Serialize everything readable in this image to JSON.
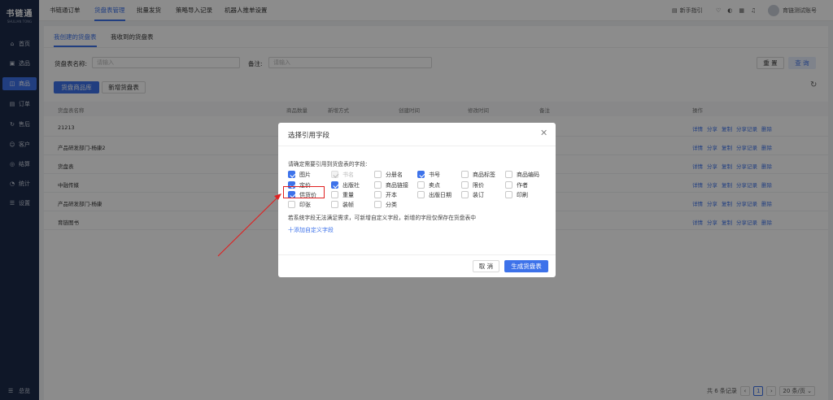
{
  "sidebar": {
    "logo_title": "书链通",
    "logo_sub": "SHULIAN TONG",
    "items": [
      {
        "label": "首页",
        "icon": "home-icon"
      },
      {
        "label": "选品",
        "icon": "select-icon"
      },
      {
        "label": "商品",
        "icon": "goods-icon"
      },
      {
        "label": "订单",
        "icon": "order-icon"
      },
      {
        "label": "售后",
        "icon": "aftersale-icon"
      },
      {
        "label": "客户",
        "icon": "customer-icon"
      },
      {
        "label": "结算",
        "icon": "settle-icon"
      },
      {
        "label": "统计",
        "icon": "stats-icon"
      },
      {
        "label": "设置",
        "icon": "settings-icon"
      }
    ],
    "active_index": 2,
    "bottom_label": "总览"
  },
  "topbar": {
    "nav": [
      "书链通订单",
      "货盘表管理",
      "批量发货",
      "策略导入记录",
      "机器人推单设置"
    ],
    "active_index": 1,
    "guide": "新手指引",
    "user": "育链测试账号"
  },
  "main": {
    "tabs": [
      "我创建的货盘表",
      "我收到的货盘表"
    ],
    "active_tab": 0,
    "filters": {
      "name_label": "货盘表名称:",
      "name_placeholder": "请输入",
      "remark_label": "备注:",
      "remark_placeholder": "请输入"
    },
    "reset_button": "重 置",
    "query_button": "查 询",
    "library_button": "货盘商品库",
    "new_button": "新增货盘表",
    "table": {
      "headers": [
        "货盘表名称",
        "商品数量",
        "新增方式",
        "创建时间",
        "修改时间",
        "备注",
        "操作"
      ],
      "rows": [
        "21213",
        "产品研发部门-杨康2",
        "货盘表",
        "中融传媒",
        "产品研发部门-杨康",
        "育链图书"
      ],
      "ops": [
        "详情",
        "分享",
        "复制",
        "分享记录",
        "删除"
      ]
    },
    "pager": {
      "total": "共 6 条记录",
      "page": "1",
      "size": "20 条/页"
    }
  },
  "dialog": {
    "title": "选择引用字段",
    "prompt": "请确定需要引用到货盘表的字段:",
    "fields": [
      {
        "label": "图片",
        "state": "on"
      },
      {
        "label": "书名",
        "state": "disabled"
      },
      {
        "label": "分册名",
        "state": "off"
      },
      {
        "label": "书号",
        "state": "on"
      },
      {
        "label": "商品标签",
        "state": "off"
      },
      {
        "label": "商品编码",
        "state": "off"
      },
      {
        "label": "定价",
        "state": "on"
      },
      {
        "label": "出版社",
        "state": "on"
      },
      {
        "label": "商品链接",
        "state": "off"
      },
      {
        "label": "卖点",
        "state": "off"
      },
      {
        "label": "限价",
        "state": "off"
      },
      {
        "label": "作者",
        "state": "off"
      },
      {
        "label": "供货价",
        "state": "on"
      },
      {
        "label": "重量",
        "state": "off"
      },
      {
        "label": "开本",
        "state": "off"
      },
      {
        "label": "出版日期",
        "state": "off"
      },
      {
        "label": "装订",
        "state": "off"
      },
      {
        "label": "印刷",
        "state": "off"
      },
      {
        "label": "印张",
        "state": "off"
      },
      {
        "label": "装帧",
        "state": "off"
      },
      {
        "label": "分类",
        "state": "off"
      }
    ],
    "note": "若系统字段无法满足需求，可新增自定义字段，新增的字段仅保存在货盘表中",
    "add_link": "十添加自定义字段",
    "cancel_button": "取 消",
    "confirm_button": "生成货盘表"
  },
  "colors": {
    "primary": "#3d72ea",
    "sidebar_bg": "#1c2a4a",
    "highlight": "#e02020"
  }
}
